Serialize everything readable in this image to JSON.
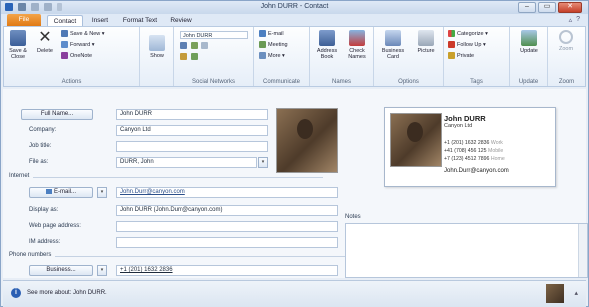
{
  "window": {
    "title": "John DURR - Contact",
    "minimize": "–",
    "maximize": "▭",
    "close": "✕"
  },
  "tabs": {
    "file": "File",
    "contact": "Contact",
    "insert": "Insert",
    "format_text": "Format Text",
    "review": "Review"
  },
  "ribbon": {
    "save_close": "Save & Close",
    "delete": "Delete",
    "save_new": "Save & New ▾",
    "forward": "Forward ▾",
    "onenote": "OneNote",
    "actions_label": "Actions",
    "show": "Show",
    "social_combo": "John DURR",
    "social_label": "Social Networks",
    "email": "E-mail",
    "meeting": "Meeting",
    "more": "More ▾",
    "communicate_label": "Communicate",
    "address_book": "Address Book",
    "check_names": "Check Names",
    "names_label": "Names",
    "business_card": "Business Card",
    "picture": "Picture",
    "options_label": "Options",
    "categorize": "Categorize ▾",
    "follow_up": "Follow Up ▾",
    "private": "Private",
    "tags_label": "Tags",
    "update": "Update",
    "update_label": "Update",
    "zoom": "Zoom",
    "zoom_label": "Zoom"
  },
  "form": {
    "full_name_btn": "Full Name...",
    "full_name": "John DURR",
    "company_label": "Company:",
    "company": "Canyon Ltd",
    "job_title_label": "Job title:",
    "job_title": "",
    "file_as_label": "File as:",
    "file_as": "DURR, John",
    "internet_section": "Internet",
    "email_btn": "E-mail...",
    "email": "John.Durr@canyon.com",
    "display_as_label": "Display as:",
    "display_as": "John DURR (John.Durr@canyon.com)",
    "web_label": "Web page address:",
    "web": "",
    "im_label": "IM address:",
    "im": "",
    "phone_section": "Phone numbers",
    "business_btn": "Business...",
    "business_phone": "+1 (201) 1632 2836",
    "notes_label": "Notes"
  },
  "card": {
    "name": "John DURR",
    "company": "Canyon Ltd",
    "phones": [
      {
        "number": "+1 (201) 1632 2836",
        "type": "Work"
      },
      {
        "number": "+41 (708) 456 125",
        "type": "Mobile"
      },
      {
        "number": "+7 (123) 4512 7896",
        "type": "Home"
      }
    ],
    "email": "John.Durr@canyon.com"
  },
  "status": {
    "text": "See more about: John DURR."
  },
  "colors": {
    "file_tab": "#e07a15",
    "accent": "#2b5fb3"
  }
}
